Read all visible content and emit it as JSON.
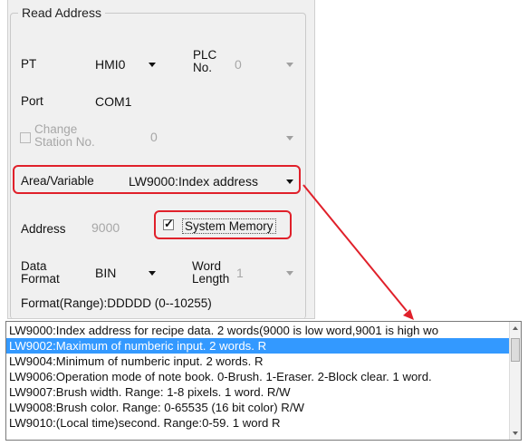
{
  "group": {
    "title": "Read Address",
    "pt": {
      "label": "PT",
      "value": "HMI0"
    },
    "plc_no": {
      "label": "PLC No.",
      "value": "0"
    },
    "port": {
      "label": "Port",
      "value": "COM1"
    },
    "change_station": {
      "label": "Change Station No.",
      "value": "0",
      "checked": false
    },
    "area_variable": {
      "label": "Area/Variable",
      "value": "LW9000:Index address"
    },
    "address": {
      "label": "Address",
      "value": "9000"
    },
    "system_memory": {
      "label": "System Memory",
      "checked": true
    },
    "data_format": {
      "label": "Data Format",
      "value": "BIN"
    },
    "word_length": {
      "label": "Word Length",
      "value": "1"
    },
    "format_range": "Format(Range):DDDDD (0--10255)"
  },
  "dropdown_list": {
    "selected_index": 1,
    "items": [
      "LW9000:Index address for recipe data. 2 words(9000 is low word,9001 is high wo",
      "LW9002:Maximum of numberic input. 2 words. R",
      "LW9004:Minimum of numberic input. 2 words. R",
      "LW9006:Operation mode of note book. 0-Brush. 1-Eraser. 2-Block clear. 1 word.",
      "LW9007:Brush width. Range: 1-8 pixels. 1 word. R/W",
      "LW9008:Brush color. Range: 0-65535 (16 bit color) R/W",
      "LW9010:(Local time)second. Range:0-59. 1 word R"
    ]
  },
  "colors": {
    "highlight": "#e0202a",
    "selection": "#3399ff"
  }
}
